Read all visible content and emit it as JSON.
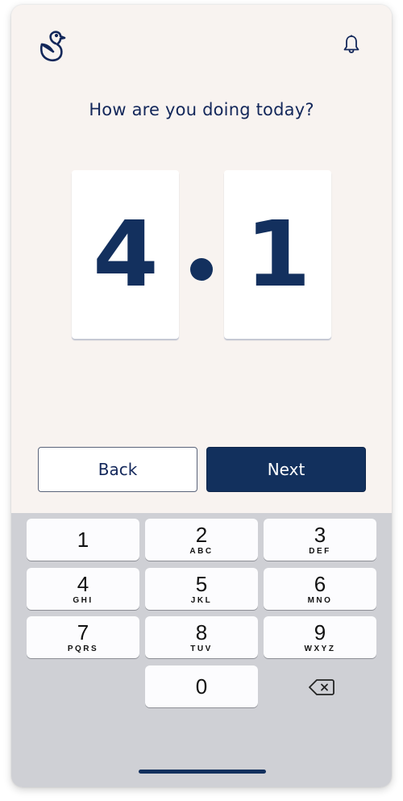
{
  "header": {
    "logo_icon": "duck-logo-icon",
    "notification_icon": "bell-icon"
  },
  "prompt": "How are you doing today?",
  "rating": {
    "whole_digit": "4",
    "decimal_digit": "1",
    "value": 4.1
  },
  "buttons": {
    "back_label": "Back",
    "next_label": "Next"
  },
  "keypad": {
    "keys": [
      {
        "num": "1",
        "letters": ""
      },
      {
        "num": "2",
        "letters": "ABC"
      },
      {
        "num": "3",
        "letters": "DEF"
      },
      {
        "num": "4",
        "letters": "GHI"
      },
      {
        "num": "5",
        "letters": "JKL"
      },
      {
        "num": "6",
        "letters": "MNO"
      },
      {
        "num": "7",
        "letters": "PQRS"
      },
      {
        "num": "8",
        "letters": "TUV"
      },
      {
        "num": "9",
        "letters": "WXYZ"
      },
      {
        "num": "0",
        "letters": ""
      }
    ],
    "delete_icon": "backspace-icon"
  },
  "colors": {
    "primary": "#12305d",
    "background": "#f8f3f0",
    "keyboard": "#cfd0d5"
  }
}
